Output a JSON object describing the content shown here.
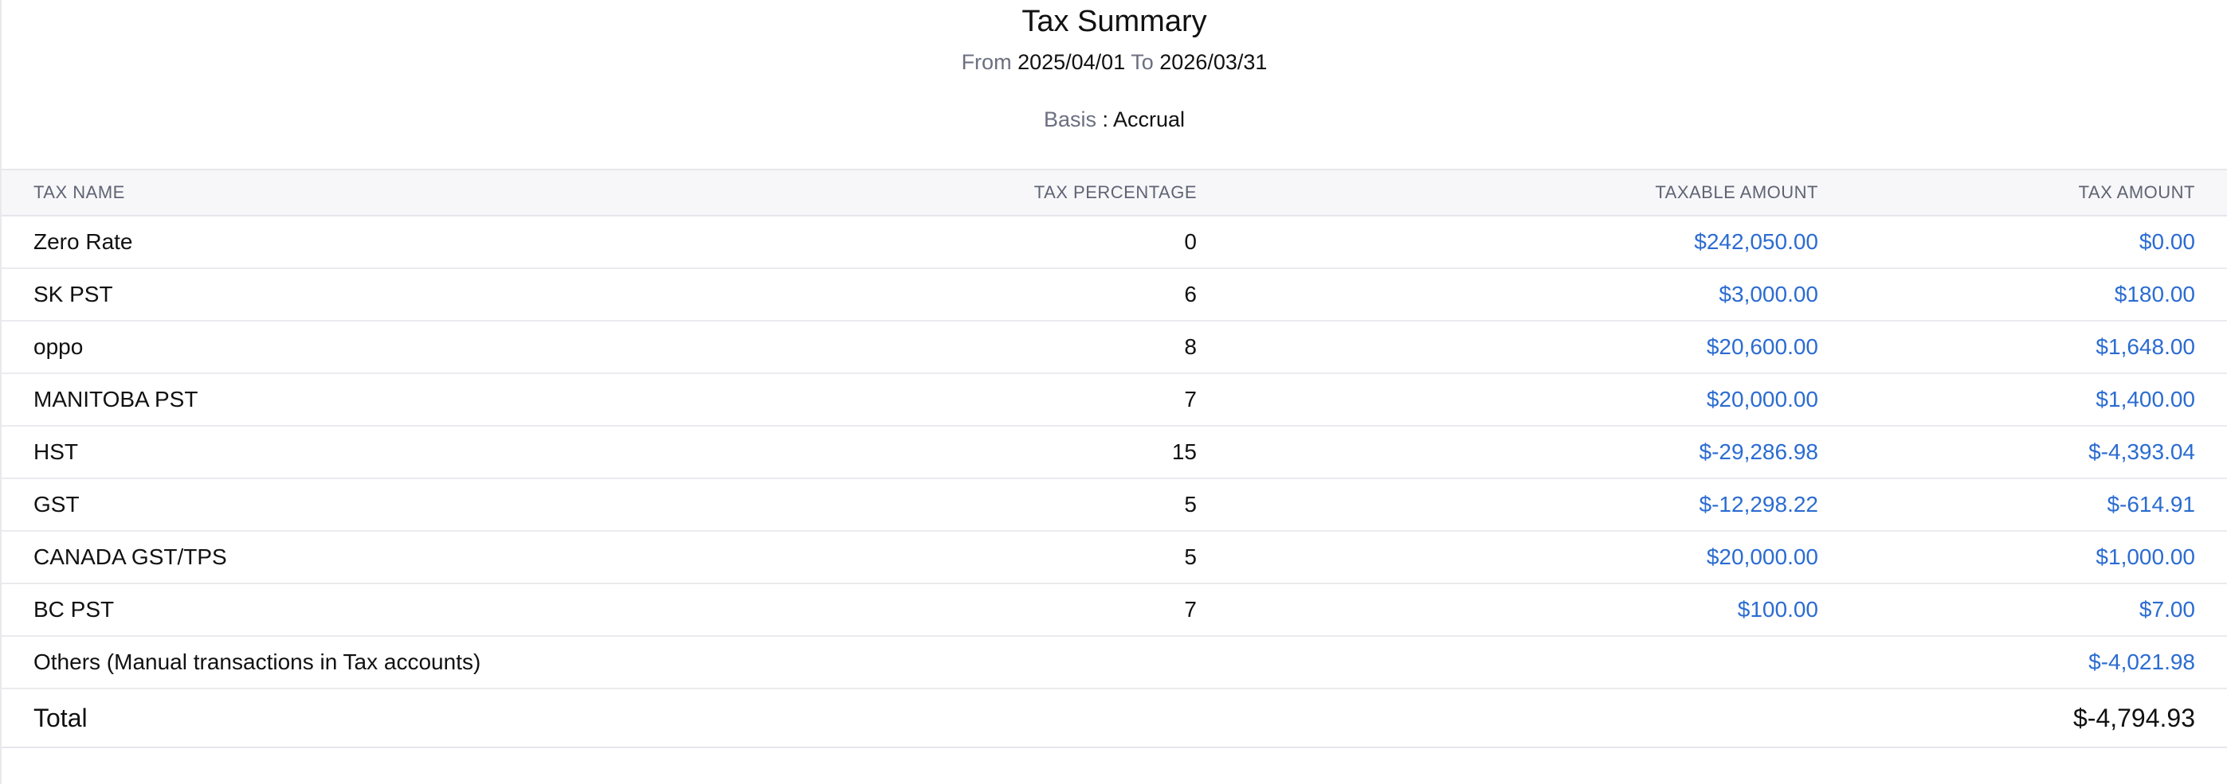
{
  "report": {
    "title": "Tax Summary",
    "from_label": "From",
    "from_date": "2025/04/01",
    "to_label": "To",
    "to_date": "2026/03/31",
    "basis_label": "Basis",
    "basis_sep": " : ",
    "basis_value": "Accrual"
  },
  "table": {
    "columns": [
      "TAX NAME",
      "TAX PERCENTAGE",
      "TAXABLE AMOUNT",
      "TAX AMOUNT"
    ],
    "rows": [
      {
        "name": "Zero Rate",
        "percentage": "0",
        "taxable": "$242,050.00",
        "tax": "$0.00"
      },
      {
        "name": "SK PST",
        "percentage": "6",
        "taxable": "$3,000.00",
        "tax": "$180.00"
      },
      {
        "name": "oppo",
        "percentage": "8",
        "taxable": "$20,600.00",
        "tax": "$1,648.00"
      },
      {
        "name": "MANITOBA PST",
        "percentage": "7",
        "taxable": "$20,000.00",
        "tax": "$1,400.00"
      },
      {
        "name": "HST",
        "percentage": "15",
        "taxable": "$-29,286.98",
        "tax": "$-4,393.04"
      },
      {
        "name": "GST",
        "percentage": "5",
        "taxable": "$-12,298.22",
        "tax": "$-614.91"
      },
      {
        "name": "CANADA GST/TPS",
        "percentage": "5",
        "taxable": "$20,000.00",
        "tax": "$1,000.00"
      },
      {
        "name": "BC PST",
        "percentage": "7",
        "taxable": "$100.00",
        "tax": "$7.00"
      }
    ],
    "others": {
      "name": "Others (Manual transactions in Tax accounts)",
      "tax": "$-4,021.98"
    },
    "total": {
      "label": "Total",
      "tax": "$-4,794.93"
    }
  },
  "colors": {
    "link": "#2b6cd1",
    "header_bg": "#f7f7fa",
    "muted_text": "#6b6f80"
  }
}
